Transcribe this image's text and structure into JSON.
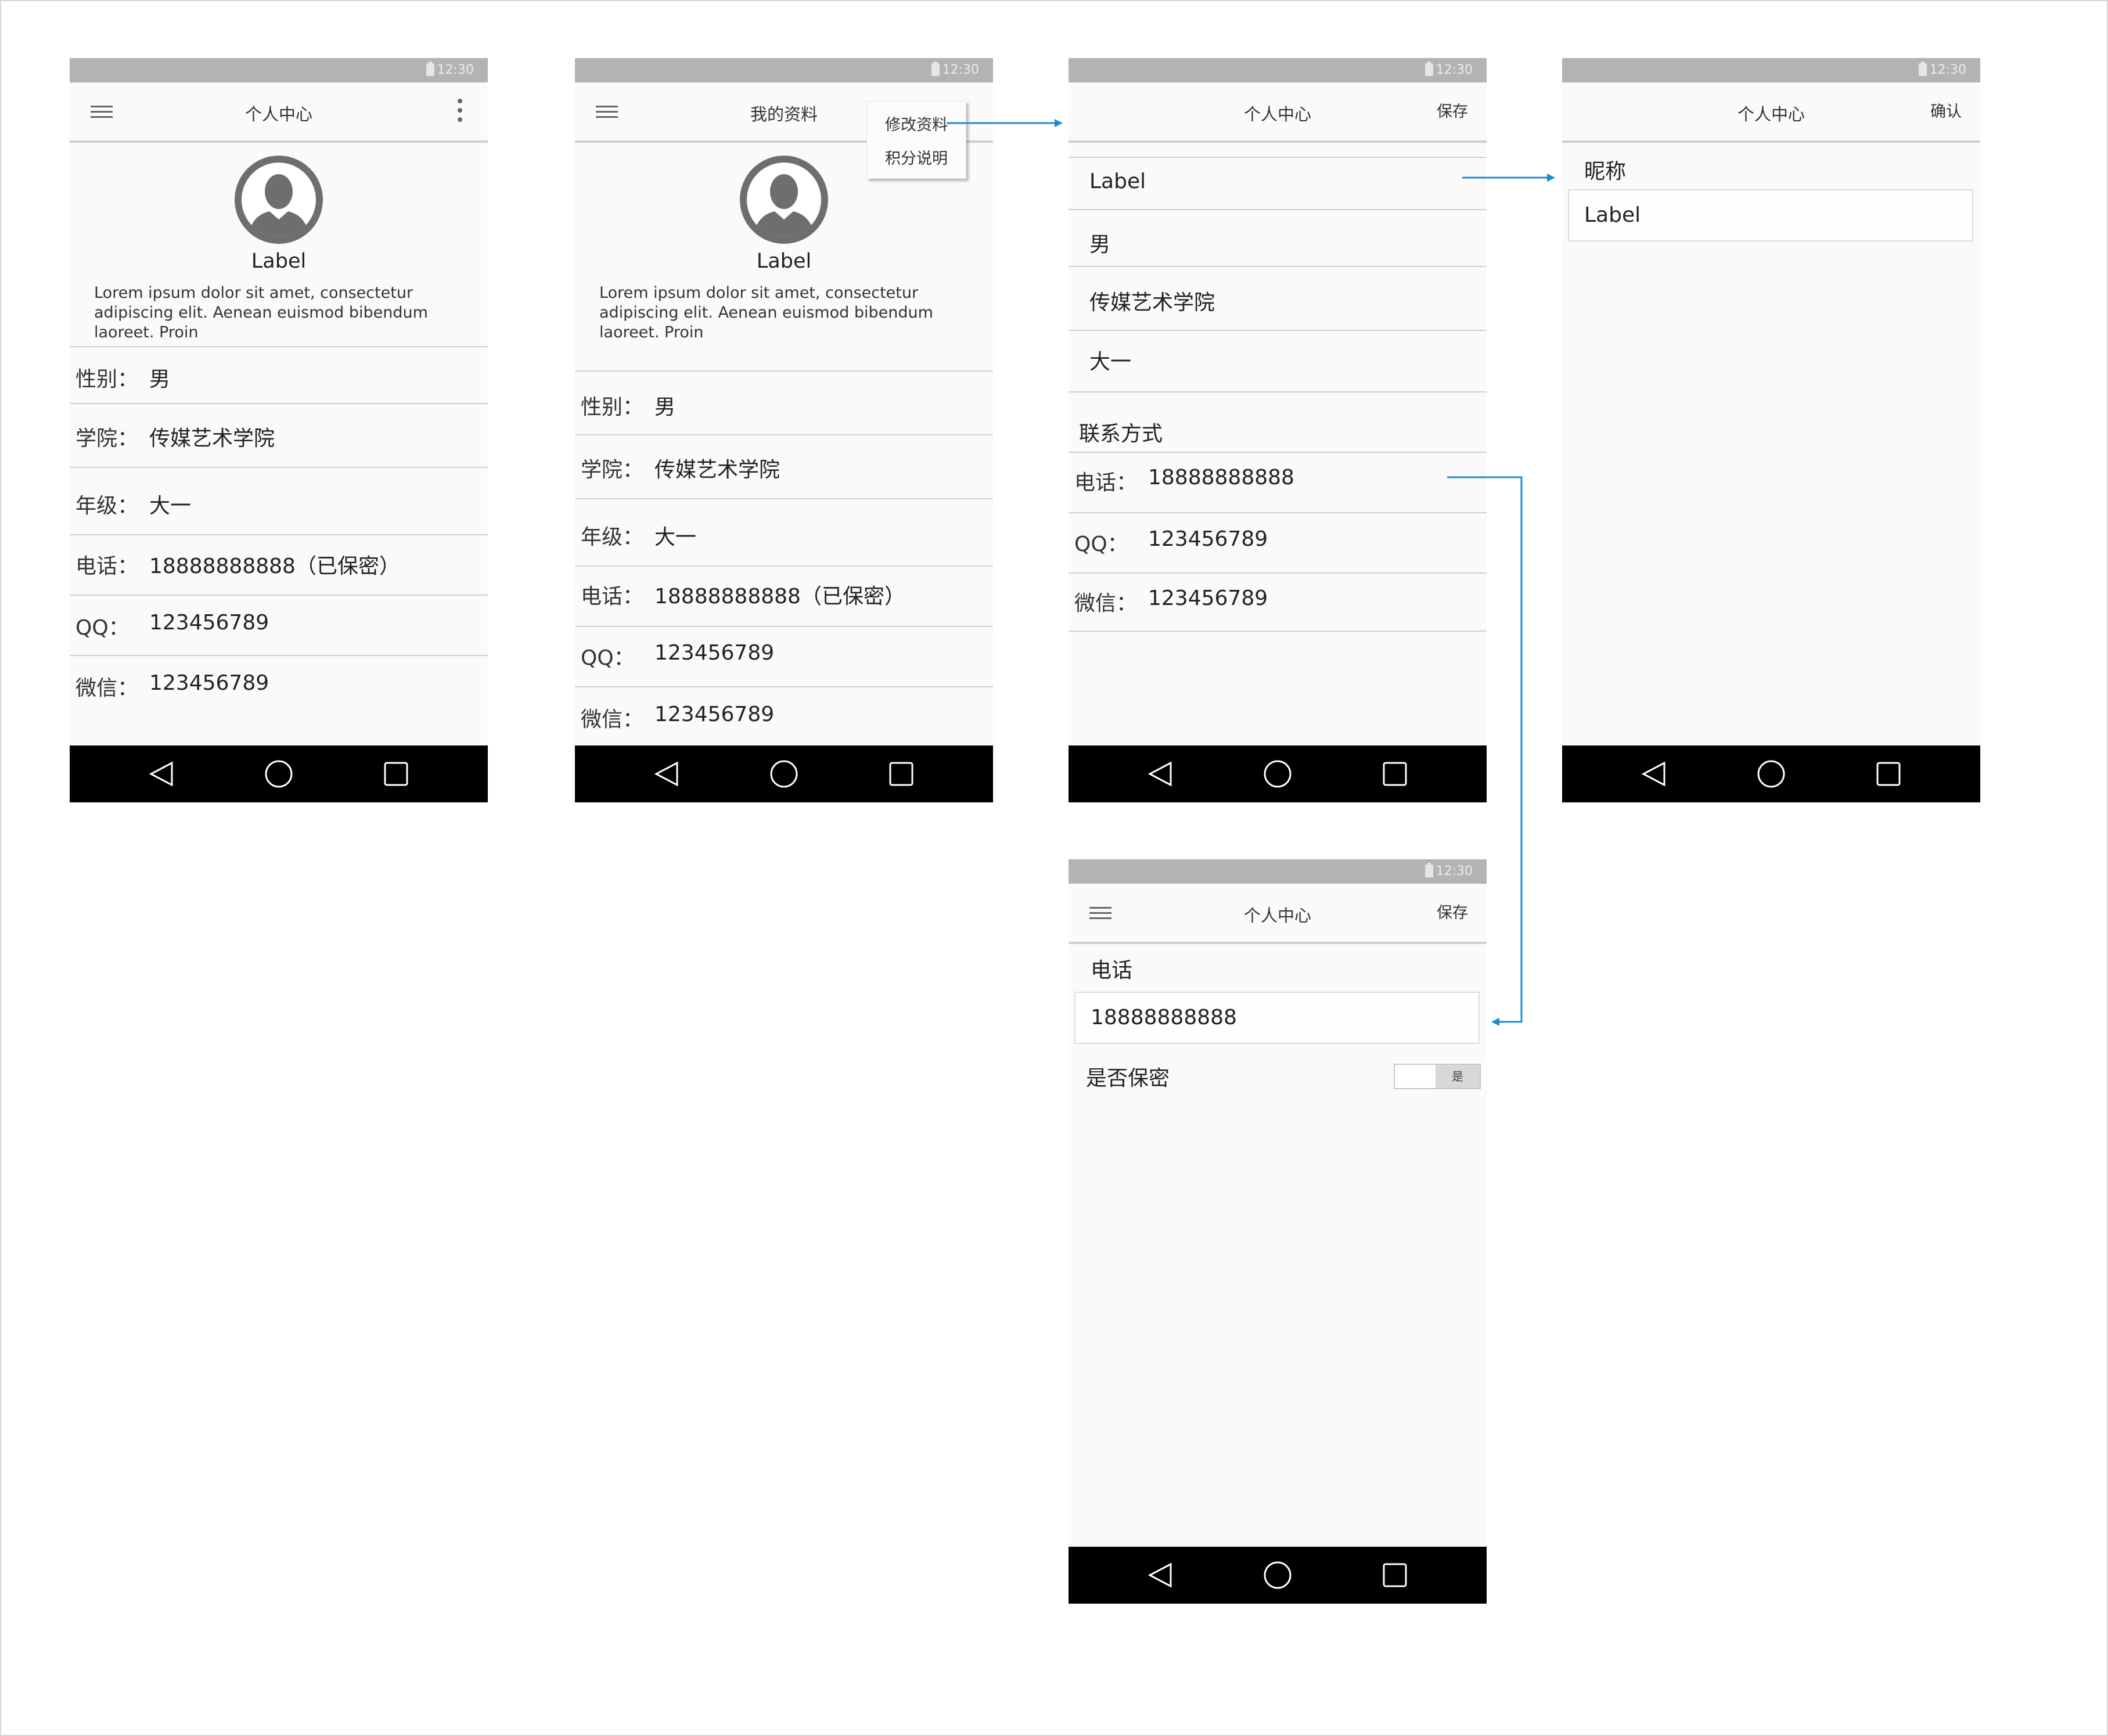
{
  "status": {
    "time": "12:30"
  },
  "screen1": {
    "title": "个人中心",
    "name": "Label",
    "description": "Lorem ipsum dolor sit amet, consectetur adipiscing elit. Aenean euismod bibendum laoreet. Proin",
    "rows": [
      {
        "label": "性别：",
        "value": "男"
      },
      {
        "label": "学院：",
        "value": "传媒艺术学院"
      },
      {
        "label": "年级：",
        "value": "大一"
      },
      {
        "label": "电话：",
        "value": "18888888888（已保密）"
      },
      {
        "label": "QQ：",
        "value": "123456789"
      },
      {
        "label": "微信：",
        "value": "123456789"
      }
    ]
  },
  "screen2": {
    "title": "我的资料",
    "menu": [
      "修改资料",
      "积分说明"
    ],
    "name": "Label",
    "description": "Lorem ipsum dolor sit amet, consectetur adipiscing elit. Aenean euismod bibendum laoreet. Proin",
    "rows": [
      {
        "label": "性别：",
        "value": "男"
      },
      {
        "label": "学院：",
        "value": "传媒艺术学院"
      },
      {
        "label": "年级：",
        "value": "大一"
      },
      {
        "label": "电话：",
        "value": "18888888888（已保密）"
      },
      {
        "label": "QQ：",
        "value": "123456789"
      },
      {
        "label": "微信：",
        "value": "123456789"
      }
    ]
  },
  "screen3": {
    "title": "个人中心",
    "action": "保存",
    "fields": [
      "Label",
      "男",
      "传媒艺术学院",
      "大一"
    ],
    "contact_header": "联系方式",
    "contacts": [
      {
        "label": "电话：",
        "value": "18888888888"
      },
      {
        "label": "QQ：",
        "value": "123456789"
      },
      {
        "label": "微信：",
        "value": "123456789"
      }
    ]
  },
  "screen4": {
    "title": "个人中心",
    "action": "确认",
    "field_label": "昵称",
    "field_value": "Label"
  },
  "screen5": {
    "title": "个人中心",
    "action": "保存",
    "field_label": "电话",
    "field_value": "18888888888",
    "secret_label": "是否保密",
    "toggle_label": "是"
  },
  "colors": {
    "connector": "#1a8bd4",
    "nav_bar": "#000000",
    "status_bar": "#b3b3b3"
  }
}
